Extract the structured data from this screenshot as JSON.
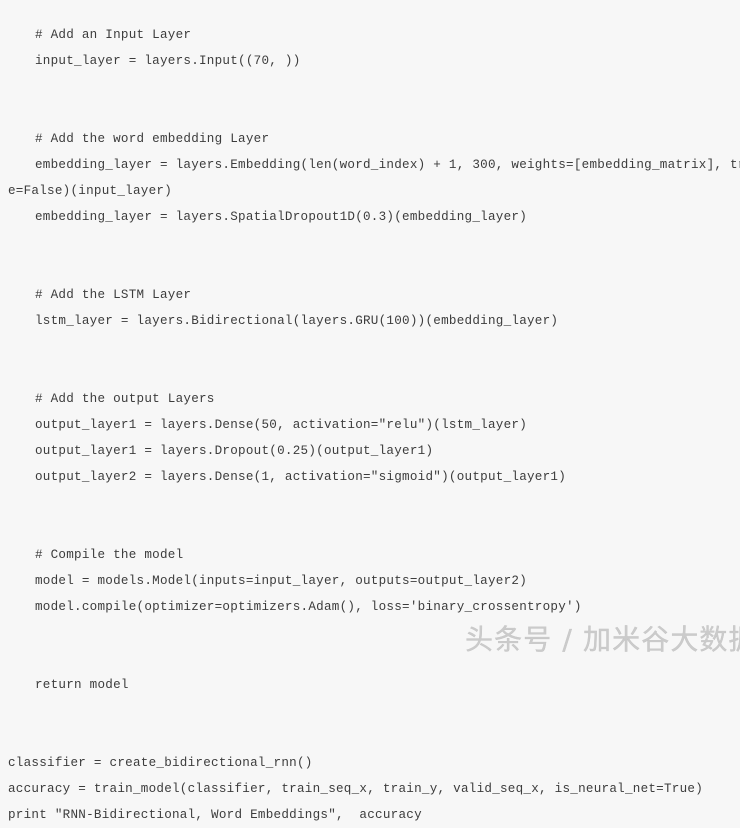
{
  "figure": {
    "kind": "code-screenshot",
    "language": "python",
    "background_color": "#f7f7f7",
    "text_color": "#3c3c3c"
  },
  "code": {
    "lines": [
      {
        "indent": 1,
        "text": "# Add an Input Layer"
      },
      {
        "indent": 1,
        "text": "input_layer = layers.Input((70, ))"
      },
      {
        "indent": 1,
        "text": ""
      },
      {
        "indent": 1,
        "text": ""
      },
      {
        "indent": 1,
        "text": "# Add the word embedding Layer"
      },
      {
        "indent": 1,
        "text": "embedding_layer = layers.Embedding(len(word_index) + 1, 300, weights=[embedding_matrix], trainabl"
      },
      {
        "indent": 0,
        "text": "e=False)(input_layer)"
      },
      {
        "indent": 1,
        "text": "embedding_layer = layers.SpatialDropout1D(0.3)(embedding_layer)"
      },
      {
        "indent": 1,
        "text": ""
      },
      {
        "indent": 1,
        "text": ""
      },
      {
        "indent": 1,
        "text": "# Add the LSTM Layer"
      },
      {
        "indent": 1,
        "text": "lstm_layer = layers.Bidirectional(layers.GRU(100))(embedding_layer)"
      },
      {
        "indent": 1,
        "text": ""
      },
      {
        "indent": 1,
        "text": ""
      },
      {
        "indent": 1,
        "text": "# Add the output Layers"
      },
      {
        "indent": 1,
        "text": "output_layer1 = layers.Dense(50, activation=\"relu\")(lstm_layer)"
      },
      {
        "indent": 1,
        "text": "output_layer1 = layers.Dropout(0.25)(output_layer1)"
      },
      {
        "indent": 1,
        "text": "output_layer2 = layers.Dense(1, activation=\"sigmoid\")(output_layer1)"
      },
      {
        "indent": 1,
        "text": ""
      },
      {
        "indent": 1,
        "text": ""
      },
      {
        "indent": 1,
        "text": "# Compile the model"
      },
      {
        "indent": 1,
        "text": "model = models.Model(inputs=input_layer, outputs=output_layer2)"
      },
      {
        "indent": 1,
        "text": "model.compile(optimizer=optimizers.Adam(), loss='binary_crossentropy')"
      },
      {
        "indent": 1,
        "text": ""
      },
      {
        "indent": 1,
        "text": ""
      },
      {
        "indent": 1,
        "text": "return model"
      },
      {
        "indent": 0,
        "text": ""
      },
      {
        "indent": 0,
        "text": ""
      },
      {
        "indent": 0,
        "text": "classifier = create_bidirectional_rnn()"
      },
      {
        "indent": 0,
        "text": "accuracy = train_model(classifier, train_seq_x, train_y, valid_seq_x, is_neural_net=True)"
      },
      {
        "indent": 0,
        "text": "print \"RNN-Bidirectional, Word Embeddings\",  accuracy"
      }
    ]
  },
  "watermark": {
    "text": "头条号 / 加米谷大数据",
    "color": "#c9c9c9"
  }
}
